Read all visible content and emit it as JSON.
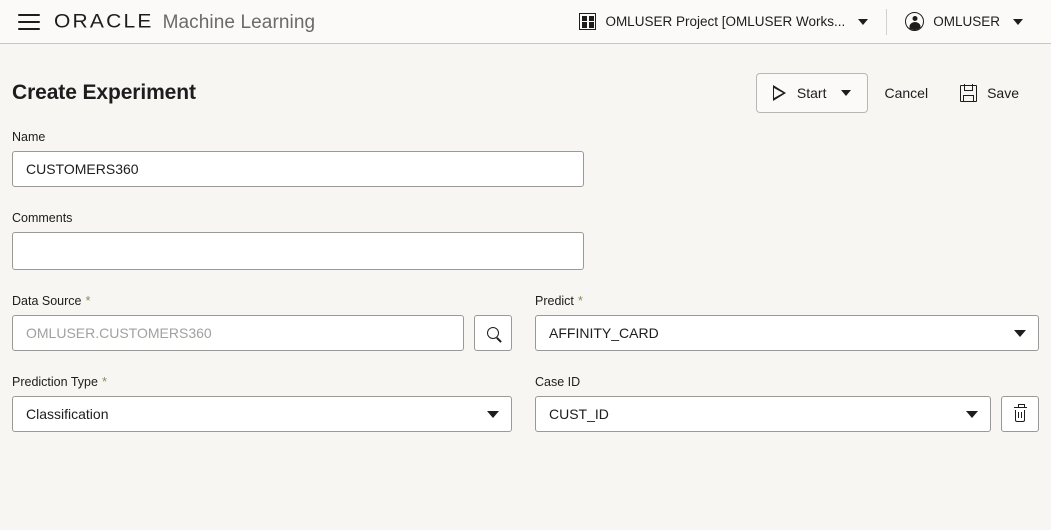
{
  "header": {
    "menu_icon": "hamburger-icon",
    "brand_primary": "ORACLE",
    "brand_secondary": "Machine Learning",
    "project_icon": "grid-icon",
    "project_label": "OMLUSER Project [OMLUSER Works...",
    "user_icon": "user-avatar-icon",
    "user_label": "OMLUSER"
  },
  "page": {
    "title": "Create Experiment"
  },
  "toolbar": {
    "start_label": "Start",
    "start_icon": "play-icon",
    "cancel_label": "Cancel",
    "save_label": "Save",
    "save_icon": "floppy-disk-icon"
  },
  "form": {
    "name": {
      "label": "Name",
      "value": "CUSTOMERS360",
      "required": false
    },
    "comments": {
      "label": "Comments",
      "value": "",
      "placeholder": "",
      "required": false
    },
    "data_source": {
      "label": "Data Source",
      "required_marker": "*",
      "value": "OMLUSER.CUSTOMERS360",
      "search_icon": "search-icon"
    },
    "predict": {
      "label": "Predict",
      "required_marker": "*",
      "value": "AFFINITY_CARD"
    },
    "prediction_type": {
      "label": "Prediction Type",
      "required_marker": "*",
      "value": "Classification"
    },
    "case_id": {
      "label": "Case ID",
      "value": "CUST_ID",
      "delete_icon": "trash-icon"
    }
  },
  "colors": {
    "page_background": "#f7f6f3",
    "header_background": "#fbfaf9",
    "text": "#1d1d1d",
    "muted_text": "#a3a19f",
    "required_star": "#8c8c5a",
    "field_border": "#9b9996"
  }
}
